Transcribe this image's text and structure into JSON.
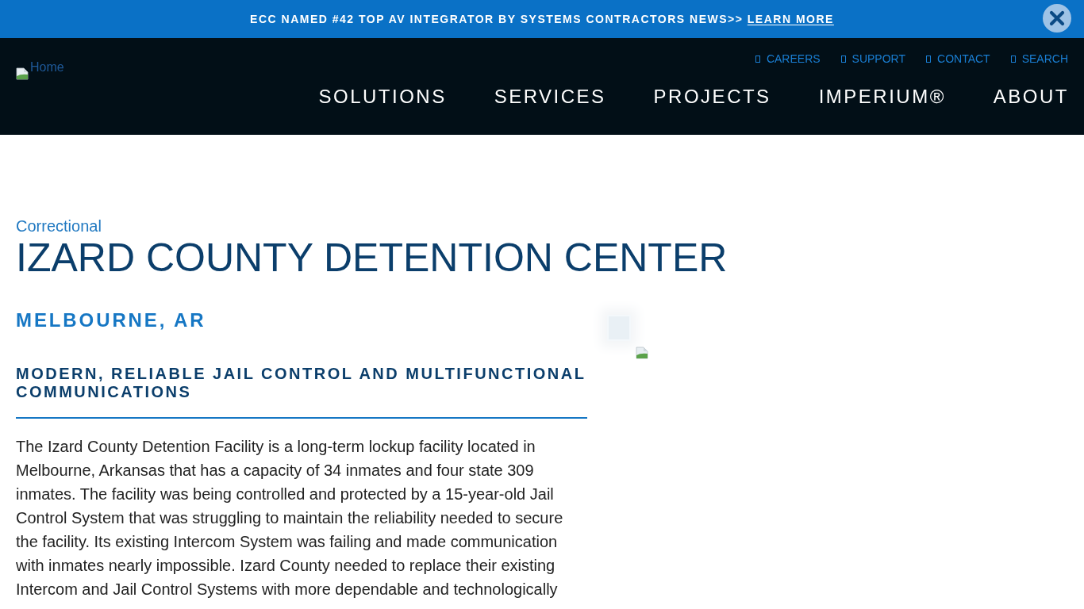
{
  "announcement": {
    "text": "ECC NAMED #42 TOP AV INTEGRATOR BY SYSTEMS CONTRACTORS NEWS>> ",
    "link": "LEARN MORE"
  },
  "header": {
    "logo_alt": "Home",
    "utility_links": [
      "CAREERS",
      "SUPPORT",
      "CONTACT",
      "SEARCH"
    ],
    "nav": [
      "SOLUTIONS",
      "SERVICES",
      "PROJECTS",
      "IMPERIUM®",
      "ABOUT"
    ]
  },
  "project": {
    "category": "Correctional",
    "title": "IZARD COUNTY DETENTION CENTER",
    "location": "MELBOURNE, AR",
    "subtitle": "MODERN, RELIABLE JAIL CONTROL AND MULTIFUNCTIONAL COMMUNICATIONS",
    "description": "The Izard County Detention Facility is a long-term lockup facility located in Melbourne, Arkansas that has a capacity of 34 inmates and four state 309 inmates. The facility was being controlled and protected by a 15-year-old Jail Control System that was struggling to maintain the reliability needed to secure the facility. Its existing Intercom System was failing and made communication with inmates nearly impossible. Izard County needed to replace their existing Intercom and Jail Control Systems with more dependable and technologically"
  }
}
